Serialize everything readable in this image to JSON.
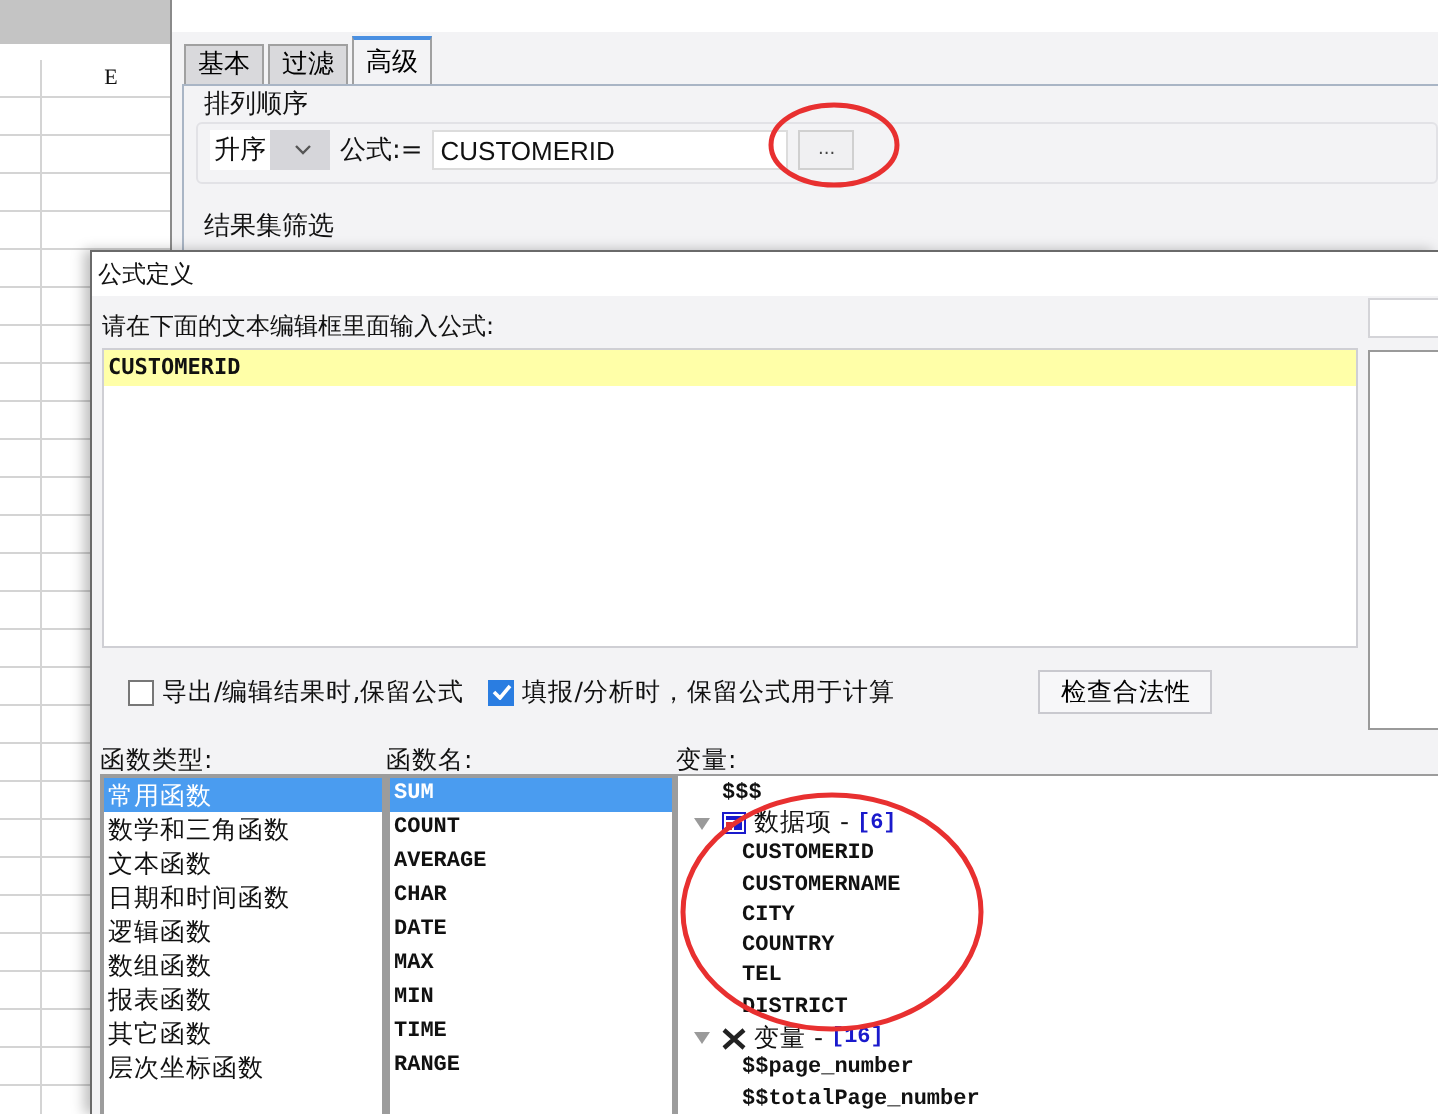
{
  "sheet": {
    "column_header": "E"
  },
  "back_dialog": {
    "tabs": [
      {
        "label": "基本",
        "selected": false
      },
      {
        "label": "过滤",
        "selected": false
      },
      {
        "label": "高级",
        "selected": true
      }
    ],
    "sort_group": {
      "title": "排列顺序",
      "order": "升序",
      "formula_label": "公式:=",
      "formula": "CUSTOMERID",
      "browse_button": "..."
    },
    "filter_group": {
      "title": "结果集筛选"
    }
  },
  "formula_dialog": {
    "title": "公式定义",
    "prompt": "请在下面的文本编辑框里面输入公式:",
    "formula": "CUSTOMERID",
    "options": [
      {
        "label": "导出/编辑结果时,保留公式",
        "checked": false
      },
      {
        "label": "填报/分析时，保留公式用于计算",
        "checked": true
      }
    ],
    "check_button": "检查合法性",
    "function_types": {
      "label": "函数类型:",
      "items": [
        {
          "label": "常用函数",
          "selected": true
        },
        {
          "label": "数学和三角函数",
          "selected": false
        },
        {
          "label": "文本函数",
          "selected": false
        },
        {
          "label": "日期和时间函数",
          "selected": false
        },
        {
          "label": "逻辑函数",
          "selected": false
        },
        {
          "label": "数组函数",
          "selected": false
        },
        {
          "label": "报表函数",
          "selected": false
        },
        {
          "label": "其它函数",
          "selected": false
        },
        {
          "label": "层次坐标函数",
          "selected": false
        }
      ]
    },
    "function_names": {
      "label": "函数名:",
      "items": [
        {
          "label": "SUM",
          "selected": true
        },
        {
          "label": "COUNT",
          "selected": false
        },
        {
          "label": "AVERAGE",
          "selected": false
        },
        {
          "label": "CHAR",
          "selected": false
        },
        {
          "label": "DATE",
          "selected": false
        },
        {
          "label": "MAX",
          "selected": false
        },
        {
          "label": "MIN",
          "selected": false
        },
        {
          "label": "TIME",
          "selected": false
        },
        {
          "label": "RANGE",
          "selected": false
        }
      ]
    },
    "variables": {
      "label": "变量:",
      "tree": [
        {
          "label": "$$$",
          "kind": "leaf"
        },
        {
          "label": "数据项 -",
          "count": "[6]",
          "kind": "data",
          "expanded": true,
          "children": [
            {
              "label": "CUSTOMERID"
            },
            {
              "label": "CUSTOMERNAME"
            },
            {
              "label": "CITY"
            },
            {
              "label": "COUNTRY"
            },
            {
              "label": "TEL"
            },
            {
              "label": "DISTRICT"
            }
          ]
        },
        {
          "label": "变量 -",
          "count": "[16]",
          "kind": "variable",
          "expanded": true,
          "children": [
            {
              "label": "$$page_number"
            },
            {
              "label": "$$totalPage_number"
            }
          ]
        }
      ]
    }
  }
}
